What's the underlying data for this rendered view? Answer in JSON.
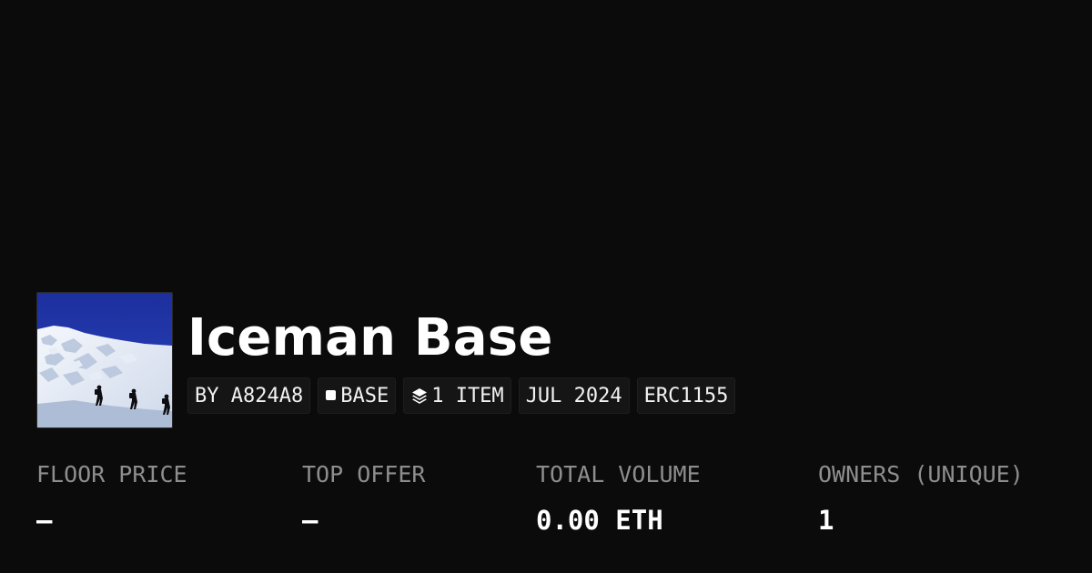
{
  "collection": {
    "title": "Iceman Base",
    "image_alt": "Climbers ascending a snowy glacier under a deep blue sky"
  },
  "tags": {
    "creator": "BY A824A8",
    "chain": "BASE",
    "chain_icon": "base-chain-square-icon",
    "items": "1 ITEM",
    "items_icon": "layers-icon",
    "date": "JUL 2024",
    "standard": "ERC1155"
  },
  "stats": [
    {
      "label": "FLOOR PRICE",
      "value": "–"
    },
    {
      "label": "TOP OFFER",
      "value": "–"
    },
    {
      "label": "TOTAL VOLUME",
      "value": "0.00 ETH"
    },
    {
      "label": "OWNERS (UNIQUE)",
      "value": "1"
    }
  ],
  "colors": {
    "background": "#0b0b0b",
    "tag_background": "#151515",
    "label_gray": "#8e8e8e",
    "text_white": "#ffffff",
    "sky_blue": "#1f36a8"
  }
}
